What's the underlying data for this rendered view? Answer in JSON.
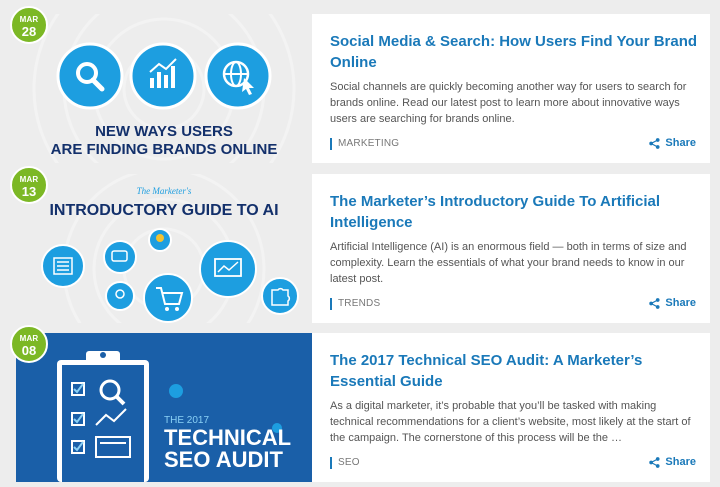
{
  "posts": [
    {
      "date": {
        "month": "MAR",
        "day": "28"
      },
      "title": "Social Media & Search: How Users Find Your Brand Online",
      "excerpt": "Social channels are quickly becoming another way for users to search for brands online. Read our latest post to learn more about innovative ways users are searching for brands online.",
      "category": "MARKETING",
      "share_label": "Share",
      "image": {
        "line1": "NEW WAYS USERS",
        "line2": "ARE FINDING BRANDS ONLINE"
      }
    },
    {
      "date": {
        "month": "MAR",
        "day": "13"
      },
      "title": "The Marketer’s Introductory Guide To Artificial Intelligence",
      "excerpt": "Artificial Intelligence (AI) is an enormous field — both in terms of size and complexity. Learn the essentials of what your brand needs to know in our latest post.",
      "category": "TRENDS",
      "share_label": "Share",
      "image": {
        "line1": "The Marketer's",
        "line2": "INTRODUCTORY GUIDE TO AI"
      }
    },
    {
      "date": {
        "month": "MAR",
        "day": "08"
      },
      "title": "The 2017 Technical SEO Audit: A Marketer’s Essential Guide",
      "excerpt": "As a digital marketer, it’s probable that you’ll be tasked with making technical recommendations for a client’s website, most likely at the start of the campaign. The cornerstone of this process will be the …",
      "category": "SEO",
      "share_label": "Share",
      "image": {
        "line1": "THE 2017",
        "line2": "TECHNICAL",
        "line3": "SEO AUDIT"
      }
    }
  ],
  "colors": {
    "accent_blue": "#1a79b9",
    "badge_green": "#7cb825",
    "icon_blue": "#1d9ee0",
    "seo_bg": "#1a5fa8",
    "headline_navy": "#13306b"
  }
}
